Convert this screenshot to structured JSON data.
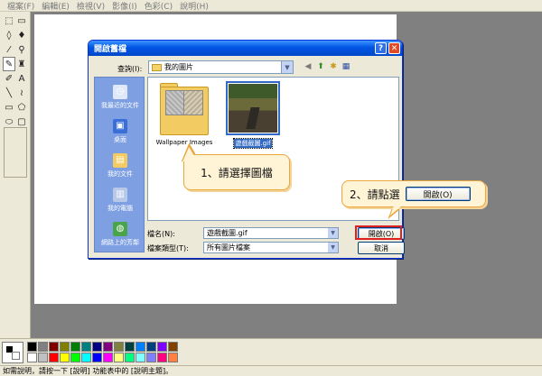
{
  "menubar": {
    "items": [
      "檔案(F)",
      "編輯(E)",
      "檢視(V)",
      "影像(I)",
      "色彩(C)",
      "說明(H)"
    ]
  },
  "tools": [
    {
      "icon": "free-select-icon",
      "glyph": "⬚"
    },
    {
      "icon": "rect-select-icon",
      "glyph": "▭"
    },
    {
      "icon": "eraser-icon",
      "glyph": "◊"
    },
    {
      "icon": "fill-icon",
      "glyph": "♦"
    },
    {
      "icon": "color-picker-icon",
      "glyph": "⁄"
    },
    {
      "icon": "magnifier-icon",
      "glyph": "⚲"
    },
    {
      "icon": "pencil-icon",
      "glyph": "✎"
    },
    {
      "icon": "brush-icon",
      "glyph": "♜"
    },
    {
      "icon": "airbrush-icon",
      "glyph": "✐"
    },
    {
      "icon": "text-icon",
      "glyph": "A"
    },
    {
      "icon": "line-icon",
      "glyph": "╲"
    },
    {
      "icon": "curve-icon",
      "glyph": "≀"
    },
    {
      "icon": "rectangle-icon",
      "glyph": "▭"
    },
    {
      "icon": "polygon-icon",
      "glyph": "⬠"
    },
    {
      "icon": "ellipse-icon",
      "glyph": "⬭"
    },
    {
      "icon": "rounded-rect-icon",
      "glyph": "▢"
    }
  ],
  "active_tool_index": 6,
  "palette": [
    "#000000",
    "#808080",
    "#800000",
    "#808000",
    "#008000",
    "#008080",
    "#000080",
    "#800080",
    "#808040",
    "#004040",
    "#0080ff",
    "#004080",
    "#8000ff",
    "#804000",
    "#ffffff",
    "#c0c0c0",
    "#ff0000",
    "#ffff00",
    "#00ff00",
    "#00ffff",
    "#0000ff",
    "#ff00ff",
    "#ffff80",
    "#00ff80",
    "#80ffff",
    "#8080ff",
    "#ff0080",
    "#ff8040"
  ],
  "status_text": "如需說明，請按一下 [說明] 功能表中的 [說明主題]。",
  "dialog": {
    "title": "開啟舊檔",
    "help_btn": "?",
    "close_btn": "✕",
    "lookin_label": "查詢(I):",
    "lookin_value": "我的圖片",
    "places": [
      {
        "label": "我最近的文件",
        "icon": "recent-docs-icon",
        "glyph": "◷",
        "color": "#dfe8f8"
      },
      {
        "label": "桌面",
        "icon": "desktop-icon",
        "glyph": "▣",
        "color": "#3a6fd8"
      },
      {
        "label": "我的文件",
        "icon": "my-documents-icon",
        "glyph": "▤",
        "color": "#f2cc62"
      },
      {
        "label": "我的電腦",
        "icon": "my-computer-icon",
        "glyph": "▥",
        "color": "#b7c8e8"
      },
      {
        "label": "網路上的芳鄰",
        "icon": "network-icon",
        "glyph": "◍",
        "color": "#4aa54a"
      }
    ],
    "files": [
      {
        "name": "Wallpaper Images",
        "type": "folder",
        "selected": false
      },
      {
        "name": "遊戲截圖.gif",
        "type": "image",
        "selected": true
      }
    ],
    "filename_label": "檔名(N):",
    "filename_value": "遊戲截圖.gif",
    "filetype_label": "檔案類型(T):",
    "filetype_value": "所有圖片檔案",
    "open_btn": "開啟(O)",
    "cancel_btn": "取消"
  },
  "callouts": {
    "step1": "1、請選擇圖檔",
    "step2": "2、請點選",
    "step2_button": "開啟(O)"
  }
}
